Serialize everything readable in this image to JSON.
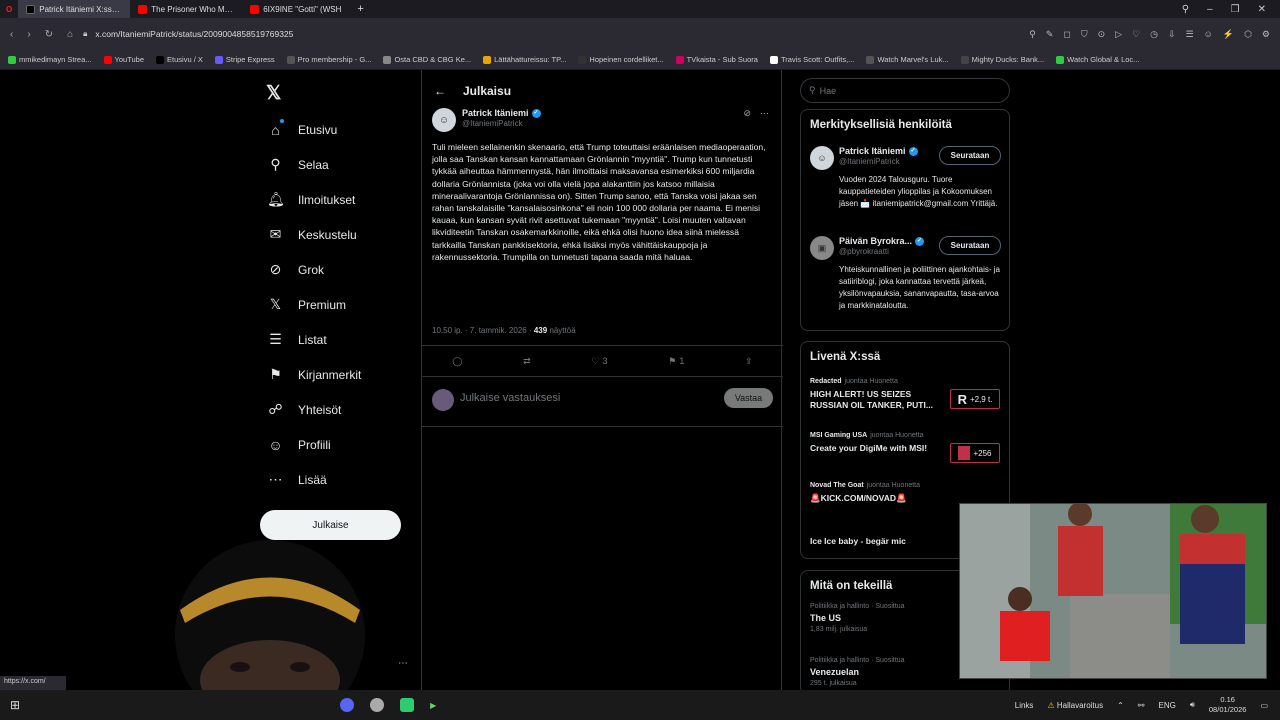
{
  "browser": {
    "tabs": [
      {
        "label": "Patrick Itäniemi X:ssä: \"@",
        "active": true,
        "color": "#000000"
      },
      {
        "label": "The Prisoner Who Made th",
        "active": false,
        "color": "#ff0000"
      },
      {
        "label": "6IX9INE \"Gotti\" (WSH",
        "active": false,
        "color": "#ff0000"
      }
    ],
    "url": "x.com/ItaniemiPatrick/status/2009004858519769325",
    "bookmarks": [
      {
        "label": "mmikedimayn Strea...",
        "color": "#2ecc40"
      },
      {
        "label": "YouTube",
        "color": "#ff0000"
      },
      {
        "label": "Etusivu / X",
        "color": "#000000"
      },
      {
        "label": "Stripe Express",
        "color": "#635bff"
      },
      {
        "label": "Pro membership - G...",
        "color": "#555555"
      },
      {
        "label": "Osta CBD & CBG Ke...",
        "color": "#888888"
      },
      {
        "label": "Lättähattureissu: TP...",
        "color": "#e6a700"
      },
      {
        "label": "Hopeinen cordelliket...",
        "color": "#333333"
      },
      {
        "label": "TVkaista - Sub Suora",
        "color": "#d1005d"
      },
      {
        "label": "Travis Scott: Outfits,...",
        "color": "#ffffff"
      },
      {
        "label": "Watch Marvel's Luk...",
        "color": "#555555"
      },
      {
        "label": "Mighty Ducks: Bank...",
        "color": "#444444"
      },
      {
        "label": "Watch Global & Loc...",
        "color": "#2ecc40"
      }
    ]
  },
  "sidebar": {
    "items": [
      {
        "label": "Etusivu",
        "icon": "home-icon",
        "glyph": "⌂"
      },
      {
        "label": "Selaa",
        "icon": "search-icon",
        "glyph": "⚲"
      },
      {
        "label": "Ilmoitukset",
        "icon": "bell-icon",
        "glyph": "🔔︎"
      },
      {
        "label": "Keskustelu",
        "icon": "mail-icon",
        "glyph": "✉"
      },
      {
        "label": "Grok",
        "icon": "grok-icon",
        "glyph": "⊘"
      },
      {
        "label": "Premium",
        "icon": "x-logo-icon",
        "glyph": "𝕏"
      },
      {
        "label": "Listat",
        "icon": "list-icon",
        "glyph": "☰"
      },
      {
        "label": "Kirjanmerkit",
        "icon": "bookmark-icon",
        "glyph": "⚑"
      },
      {
        "label": "Yhteisöt",
        "icon": "communities-icon",
        "glyph": "☍"
      },
      {
        "label": "Profiili",
        "icon": "profile-icon",
        "glyph": "☺"
      },
      {
        "label": "Lisää",
        "icon": "more-icon",
        "glyph": "⋯"
      }
    ],
    "post_button": "Julkaise"
  },
  "post": {
    "header_title": "Julkaisu",
    "author_name": "Patrick Itäniemi",
    "author_handle": "@ItaniemiPatrick",
    "text": "Tuli mieleen sellainenkin skenaario, että Trump toteuttaisi eräänlaisen mediaoperaation, jolla saa Tanskan kansan kannattamaan Grönlannin \"myyntiä\". Trump kun tunnetusti tykkää aiheuttaa hämmennystä, hän ilmoittaisi maksavansa esimerkiksi 600 miljardia dollaria Grönlannista (joka voi olla vielä jopa alakanttiin jos katsoo millaisia mineraalivarantoja Grönlannissa on). Sitten Trump sanoo, että Tanska voisi jakaa sen rahan tanskalaisille \"kansalaisosinkona\" eli noin 100 000 dollaria per naama. Ei menisi kauaa, kun kansan syvät rivit asettuvat tukemaan \"myyntiä\". Loisi muuten valtavan likviditeetin Tanskan osakemarkkinoille, eikä ehkä olisi huono idea siinä mielessä tarkkailla Tanskan pankkisektoria, ehkä lisäksi myös vähittäiskauppoja ja rakennussektoria. Trumpilla on tunnetusti tapana saada mitä haluaa.",
    "time": "10.50 ip. · 7. tammik. 2026 · ",
    "views": "439",
    "views_label": " näyttöä",
    "likes": "3",
    "bookmarks": "1",
    "reply_placeholder": "Julkaise vastauksesi",
    "reply_button": "Vastaa"
  },
  "right": {
    "search_placeholder": "Hae",
    "relevant_title": "Merkityksellisiä henkilöitä",
    "people": [
      {
        "name": "Patrick Itäniemi",
        "handle": "@ItaniemiPatrick",
        "follow": "Seurataan",
        "bio": "Vuoden 2024 Talousguru. Tuore kauppatieteiden ylioppilas ja Kokoomuksen jäsen 📩 itaniemipatrick@gmail.com Yrittäjä."
      },
      {
        "name": "Päivän Byrokra...",
        "handle": "@pbyrokraatti",
        "follow": "Seurataan",
        "bio": "Yhteiskunnallinen ja poliittinen ajankohtais- ja satiiriblogi, joka kannattaa tervettä järkeä, yksilönvapauksia, sananvapautta, tasa-arvoa ja markkinataloutta."
      }
    ],
    "live_title": "Livenä X:ssä",
    "live": [
      {
        "host": "Redacted",
        "status": "juontaa Huonetta",
        "title": "HIGH ALERT! US SEIZES RUSSIAN OIL TANKER, PUTI...",
        "badge": "+2,9 t."
      },
      {
        "host": "MSI Gaming USA",
        "status": "juontaa Huonetta",
        "title": "Create your DigiMe with MSI!",
        "badge": "+256"
      },
      {
        "host": "Novad The Goat",
        "status": "juontaa Huonetta",
        "title": "🚨KICK.COM/NOVAD🚨",
        "badge": ""
      },
      {
        "host": "",
        "status": "",
        "title": "Ice Ice baby - begär mic",
        "badge": ""
      }
    ],
    "trends_title": "Mitä on tekeillä",
    "trends": [
      {
        "category": "Politiikka ja hallinto · Suosittua",
        "name": "The US",
        "posts": "1,83 milj. julkaisua"
      },
      {
        "category": "Politiikka ja hallinto · Suosittua",
        "name": "Venezuelan",
        "posts": "295 t. julkaisua"
      }
    ]
  },
  "overlay": {
    "status_link": "https://x.com/"
  },
  "taskbar": {
    "links": "Links",
    "weather": "Hallavaroitus",
    "lang": "ENG",
    "time": "0.16",
    "date": "08/01/2026"
  }
}
